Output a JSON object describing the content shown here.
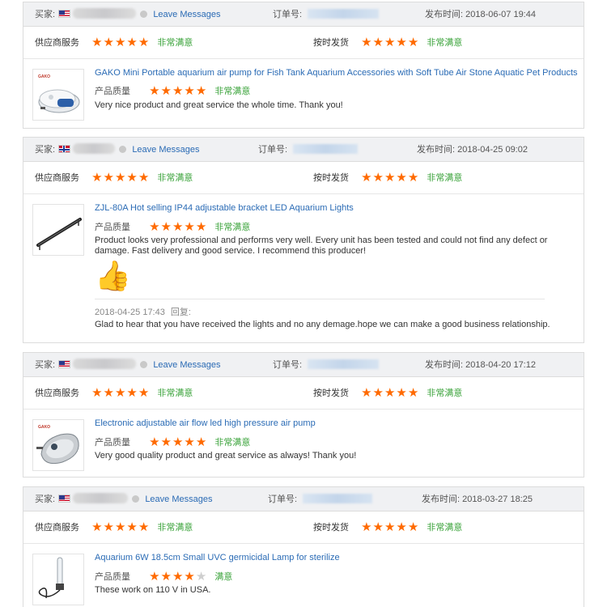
{
  "labels": {
    "buyer": "买家:",
    "leave_messages": "Leave Messages",
    "order_no": "订单号:",
    "posted_time": "发布时间:",
    "supplier_service": "供应商服务",
    "on_time_delivery": "按时发货",
    "product_quality": "产品质量",
    "reply": "回复:"
  },
  "colors": {
    "accent_link": "#2a6bb5",
    "stars": "#ff6a00",
    "verdict": "#3aa33a",
    "header_bg": "#f0f1f3"
  },
  "reviews": [
    {
      "flag": "us-flag",
      "posted_time": "2018-06-07 19:44",
      "supplier_service_stars": 5,
      "supplier_service_verdict": "非常满意",
      "on_time_stars": 5,
      "on_time_verdict": "非常满意",
      "product_title": "GAKO Mini Portable aquarium air pump for Fish Tank Aquarium Accessories with Soft Tube Air Stone Aquatic Pet Products",
      "product_quality_stars": 5,
      "product_quality_verdict": "非常满意",
      "review_text": "Very nice product and great service the whole time. Thank you!"
    },
    {
      "flag": "norway-flag",
      "posted_time": "2018-04-25 09:02",
      "supplier_service_stars": 5,
      "supplier_service_verdict": "非常满意",
      "on_time_stars": 5,
      "on_time_verdict": "非常满意",
      "product_title": "ZJL-80A Hot selling IP44 adjustable bracket LED Aquarium Lights",
      "product_quality_stars": 5,
      "product_quality_verdict": "非常满意",
      "review_text": "Product looks very professional and performs very well. Every unit has been tested and could not find any defect or damage. Fast delivery and good service. I recommend this producer!",
      "emoji": "👍",
      "reply_time": "2018-04-25 17:43",
      "reply_text": "Glad to hear that you have received the lights and no any demage.hope we can make a good business relationship."
    },
    {
      "flag": "us-flag",
      "posted_time": "2018-04-20 17:12",
      "supplier_service_stars": 5,
      "supplier_service_verdict": "非常满意",
      "on_time_stars": 5,
      "on_time_verdict": "非常满意",
      "product_title": "Electronic adjustable air flow led high pressure air pump",
      "product_quality_stars": 5,
      "product_quality_verdict": "非常满意",
      "review_text": "Very good quality product and great service as always! Thank you!"
    },
    {
      "flag": "us-flag",
      "posted_time": "2018-03-27 18:25",
      "supplier_service_stars": 5,
      "supplier_service_verdict": "非常满意",
      "on_time_stars": 5,
      "on_time_verdict": "非常满意",
      "product_title": "Aquarium 6W 18.5cm Small UVC germicidal Lamp for sterilize",
      "product_quality_stars": 4,
      "product_quality_verdict": "满意",
      "review_text": "These work on 110 V in USA."
    }
  ]
}
